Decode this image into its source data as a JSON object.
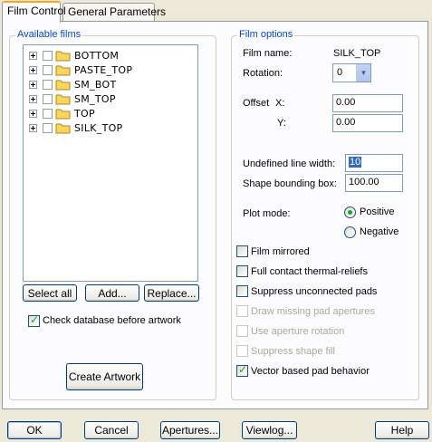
{
  "tabs": {
    "film_control": "Film Control",
    "general_parameters": "General Parameters"
  },
  "available_films": {
    "label": "Available films",
    "items": [
      {
        "name": "BOTTOM"
      },
      {
        "name": "PASTE_TOP"
      },
      {
        "name": "SM_BOT"
      },
      {
        "name": "SM_TOP"
      },
      {
        "name": "TOP"
      },
      {
        "name": "SILK_TOP"
      }
    ],
    "select_all": "Select all",
    "add": "Add...",
    "replace": "Replace..."
  },
  "check_database": {
    "label": "Check database before artwork",
    "checked": true
  },
  "create_artwork": "Create Artwork",
  "film_options": {
    "label": "Film options",
    "film_name_label": "Film name:",
    "film_name_value": "SILK_TOP",
    "rotation_label": "Rotation:",
    "rotation_value": "0",
    "offset_label": "Offset",
    "x_label": "X:",
    "x_value": "0.00",
    "y_label": "Y:",
    "y_value": "0.00",
    "undefined_line_width_label": "Undefined line width:",
    "undefined_line_width_value": "10",
    "shape_bounding_box_label": "Shape bounding box:",
    "shape_bounding_box_value": "100.00",
    "plot_mode_label": "Plot mode:",
    "plot_mode_positive": "Positive",
    "plot_mode_negative": "Negative",
    "plot_mode_selected": "Positive",
    "checkboxes": {
      "film_mirrored": "Film mirrored",
      "full_contact": "Full contact thermal-reliefs",
      "suppress_unconnected": "Suppress unconnected pads",
      "draw_missing": "Draw missing pad apertures",
      "use_aperture_rotation": "Use aperture rotation",
      "suppress_shape_fill": "Suppress shape fill",
      "vector_based": "Vector based pad behavior"
    }
  },
  "footer": {
    "ok": "OK",
    "cancel": "Cancel",
    "apertures": "Apertures...",
    "viewlog": "Viewlog...",
    "help": "Help"
  },
  "colors": {
    "accent": "#0046d5",
    "check": "#21a121",
    "folder": "#f5d760"
  }
}
